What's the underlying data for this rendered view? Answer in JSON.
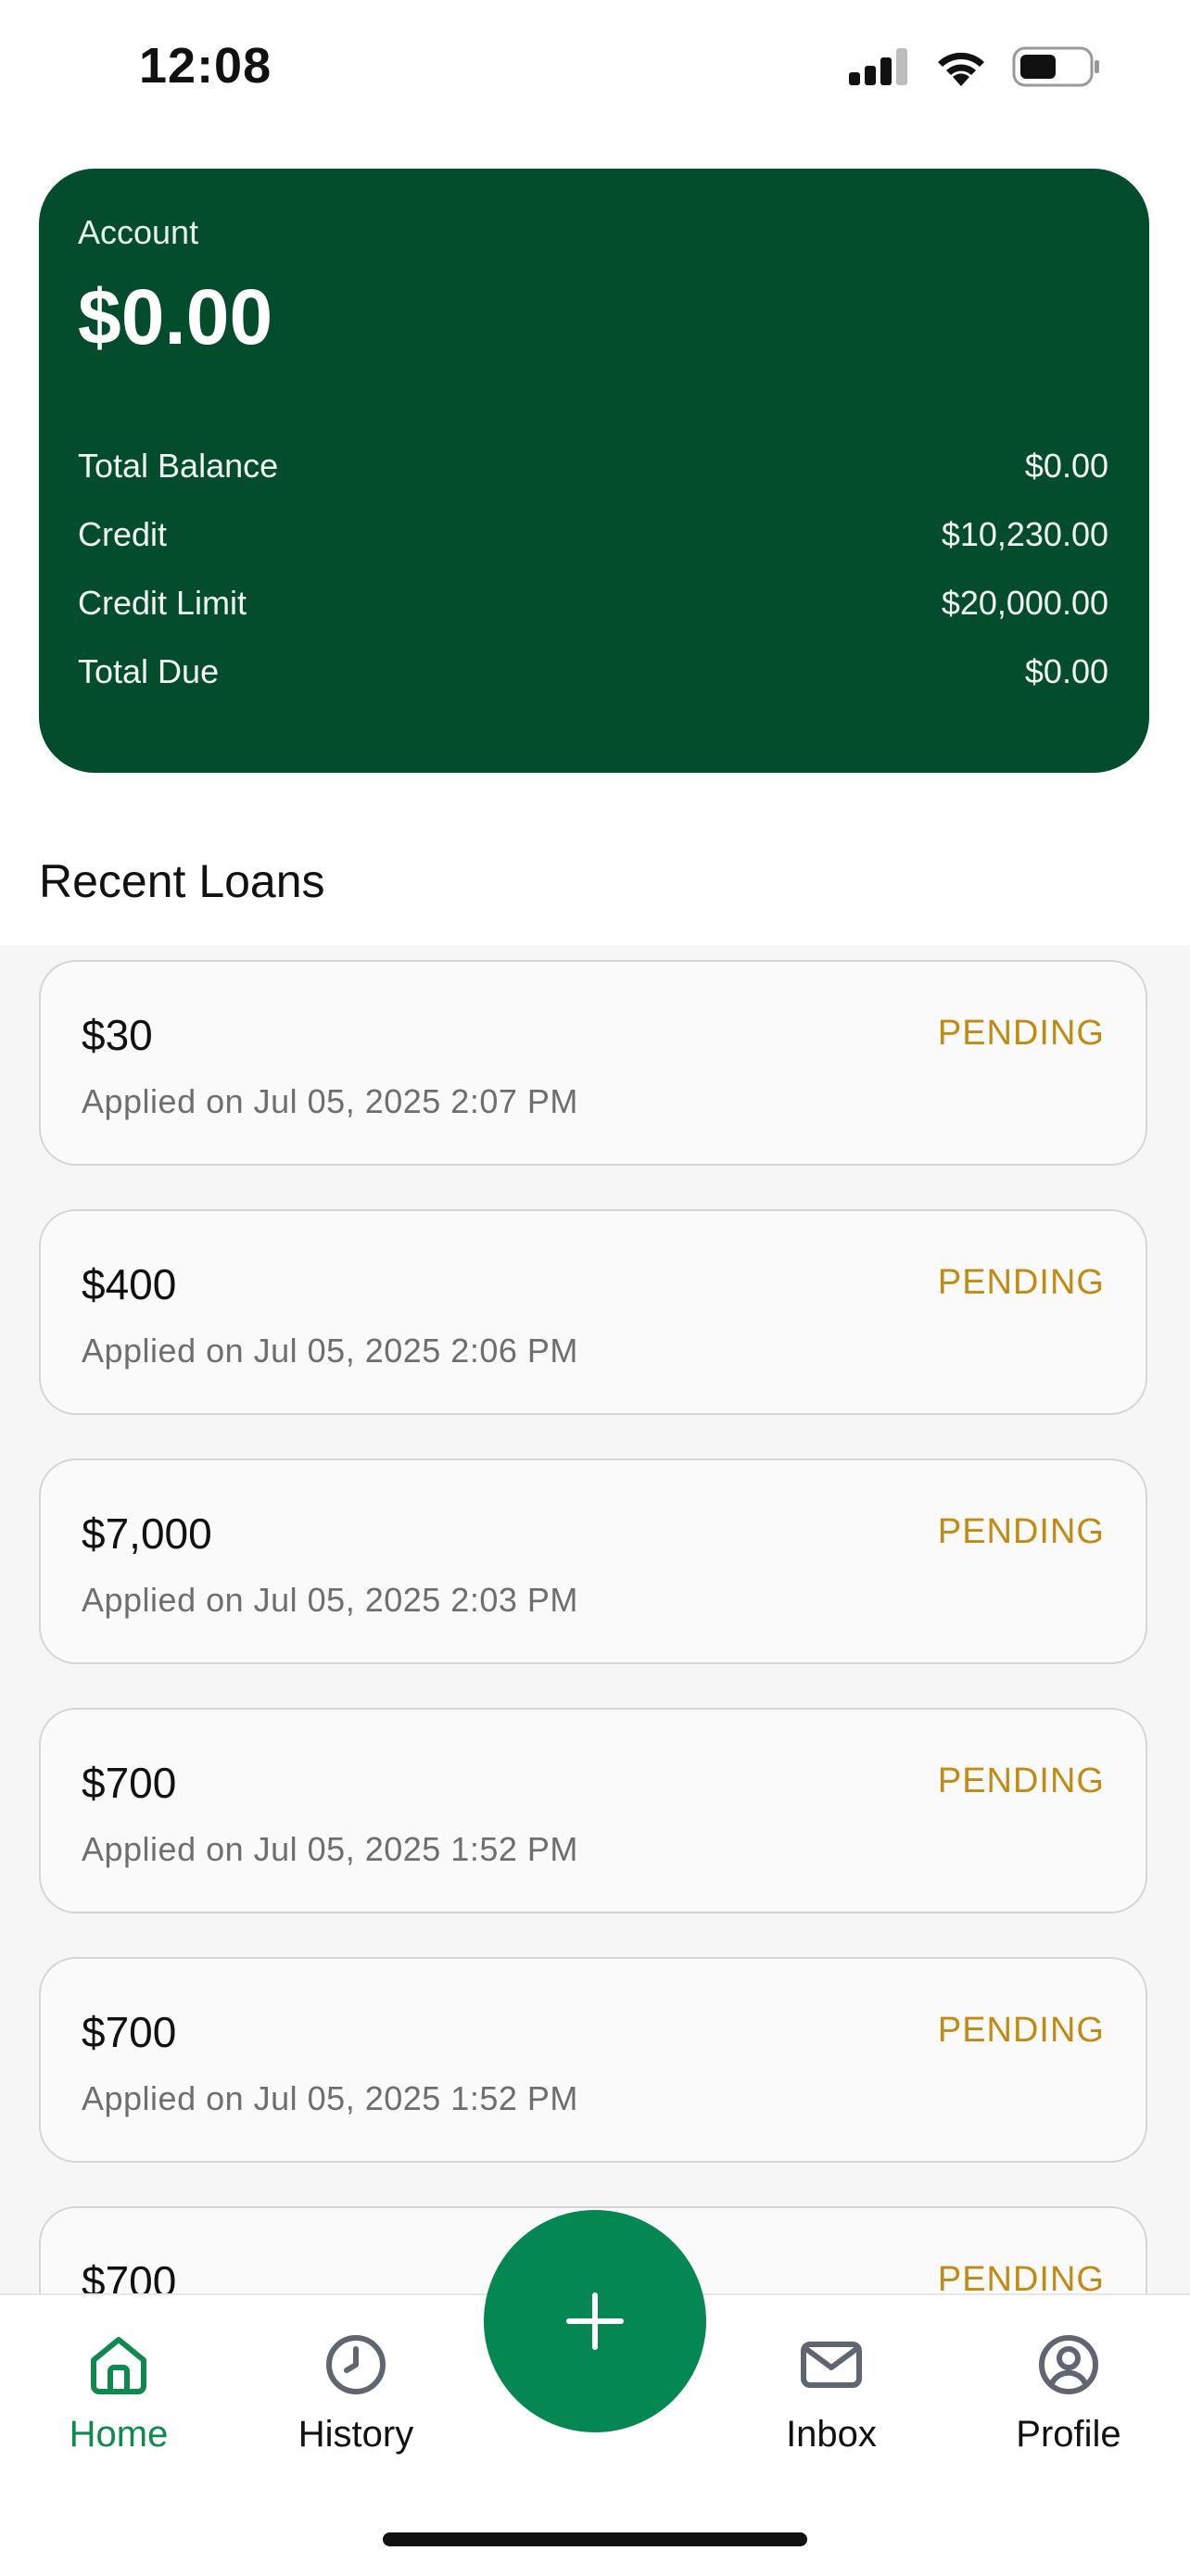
{
  "status_bar": {
    "time": "12:08"
  },
  "account": {
    "label": "Account",
    "amount": "$0.00",
    "rows": [
      {
        "label": "Total Balance",
        "value": "$0.00"
      },
      {
        "label": "Credit",
        "value": "$10,230.00"
      },
      {
        "label": "Credit Limit",
        "value": "$20,000.00"
      },
      {
        "label": "Total Due",
        "value": "$0.00"
      }
    ]
  },
  "recent_loans": {
    "title": "Recent Loans",
    "items": [
      {
        "amount": "$30",
        "date": "Applied on Jul 05, 2025 2:07 PM",
        "status": "PENDING"
      },
      {
        "amount": "$400",
        "date": "Applied on Jul 05, 2025 2:06 PM",
        "status": "PENDING"
      },
      {
        "amount": "$7,000",
        "date": "Applied on Jul 05, 2025 2:03 PM",
        "status": "PENDING"
      },
      {
        "amount": "$700",
        "date": "Applied on Jul 05, 2025 1:52 PM",
        "status": "PENDING"
      },
      {
        "amount": "$700",
        "date": "Applied on Jul 05, 2025 1:52 PM",
        "status": "PENDING"
      },
      {
        "amount": "$700",
        "date": "",
        "status": "PENDING"
      }
    ]
  },
  "nav": {
    "home": "Home",
    "history": "History",
    "inbox": "Inbox",
    "profile": "Profile",
    "active": "home",
    "fab_icon": "plus-icon"
  },
  "colors": {
    "card": "#034d2c",
    "accent": "#058752",
    "pending": "#c38a11"
  }
}
